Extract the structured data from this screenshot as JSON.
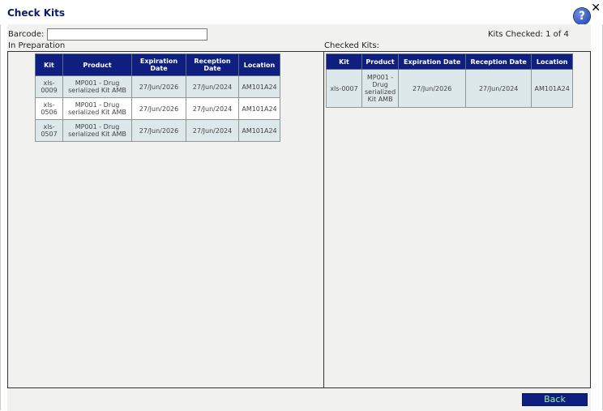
{
  "header": {
    "title": "Check Kits",
    "help_symbol": "?",
    "close_symbol": "✕"
  },
  "barcode": {
    "label": "Barcode:",
    "value": ""
  },
  "kits_checked": "Kits Checked: 1 of 4",
  "left_panel": {
    "label": "In Preparation",
    "columns": [
      "Kit",
      "Product",
      "Expiration Date",
      "Reception Date",
      "Location"
    ],
    "rows": [
      {
        "kit": "xls-0009",
        "product": "MP001 - Drug serialized Kit AMB",
        "exp": "27/Jun/2026",
        "rec": "27/Jun/2024",
        "loc": "AM101A24"
      },
      {
        "kit": "xls-0506",
        "product": "MP001 - Drug serialized Kit AMB",
        "exp": "27/Jun/2026",
        "rec": "27/Jun/2024",
        "loc": "AM101A24"
      },
      {
        "kit": "xls-0507",
        "product": "MP001 - Drug serialized Kit AMB",
        "exp": "27/Jun/2026",
        "rec": "27/Jun/2024",
        "loc": "AM101A24"
      }
    ]
  },
  "right_panel": {
    "label": "Checked Kits:",
    "columns": [
      "Kit",
      "Product",
      "Expiration Date",
      "Reception Date",
      "Location"
    ],
    "rows": [
      {
        "kit": "xls-0007",
        "product": "MP001 - Drug serialized Kit AMB",
        "exp": "27/Jun/2026",
        "rec": "27/Jun/2024",
        "loc": "AM101A24"
      }
    ]
  },
  "footer": {
    "back_label": "Back"
  },
  "colors": {
    "header_bg": "#0f1f80",
    "row_alt": "#dce8ea",
    "title": "#0a1a6b",
    "back_text": "#9ef09e"
  }
}
